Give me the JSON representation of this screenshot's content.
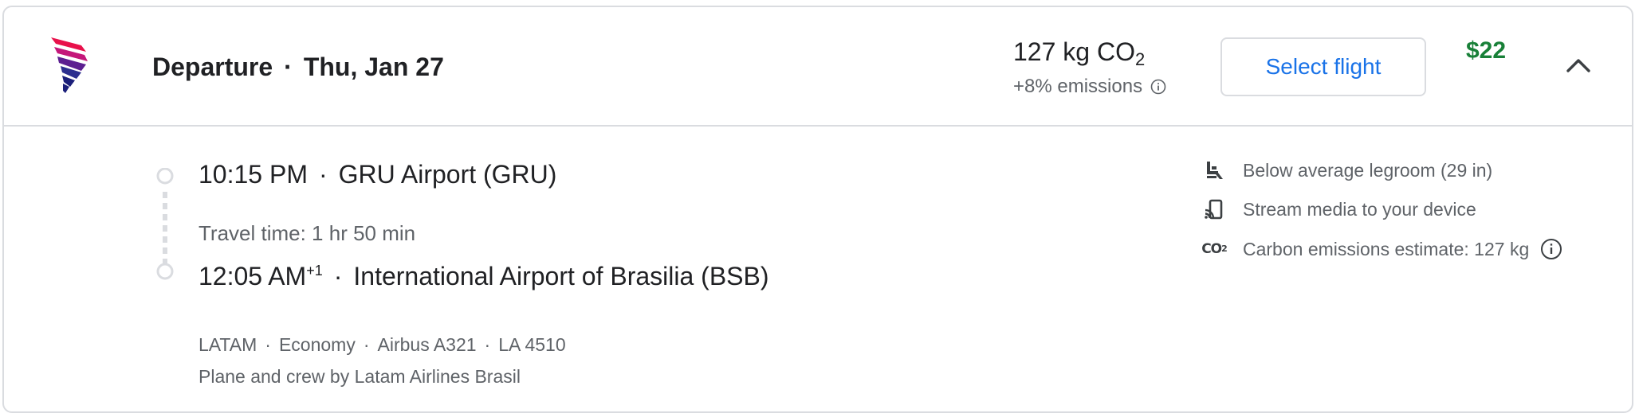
{
  "header": {
    "airline_logo": "latam-logo",
    "direction_label": "Departure",
    "separator": "·",
    "date": "Thu, Jan 27",
    "co2_value": "127 kg CO",
    "co2_sub": "2",
    "emissions_delta": "+8% emissions",
    "select_button_label": "Select flight",
    "price": "$22",
    "collapse_icon": "chevron-up-icon",
    "price_color": "#188038",
    "accent_color": "#1a73e8"
  },
  "itinerary": {
    "departure": {
      "time": "10:15 PM",
      "airport": "GRU Airport (GRU)"
    },
    "travel_time": "Travel time: 1 hr 50 min",
    "arrival": {
      "time": "12:05 AM",
      "day_offset": "+1",
      "airport": "International Airport of Brasilia (BSB)"
    },
    "details": {
      "airline": "LATAM",
      "cabin": "Economy",
      "aircraft": "Airbus A321",
      "flight_number": "LA 4510",
      "operator_note": "Plane and crew by Latam Airlines Brasil"
    }
  },
  "amenities": [
    {
      "icon": "legroom-seat-icon",
      "label": "Below average legroom (29 in)"
    },
    {
      "icon": "cast-stream-icon",
      "label": "Stream media to your device"
    },
    {
      "icon": "co2-icon",
      "label": "Carbon emissions estimate: 127 kg"
    }
  ]
}
